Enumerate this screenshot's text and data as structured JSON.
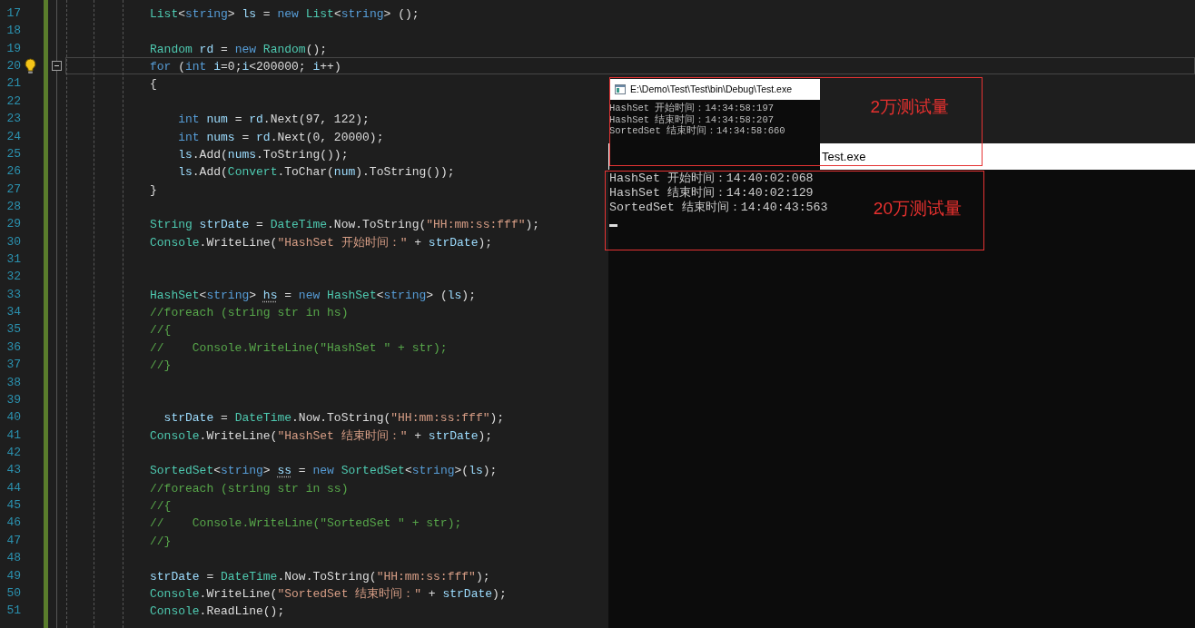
{
  "editor": {
    "lines": [
      {
        "number": "17",
        "current": false,
        "lightbulb": false,
        "fold": false,
        "tokens": [
          {
            "kind": "type",
            "text": "List"
          },
          {
            "kind": "plain",
            "text": "<"
          },
          {
            "kind": "keyword",
            "text": "string"
          },
          {
            "kind": "plain",
            "text": "> "
          },
          {
            "kind": "variable",
            "text": "ls"
          },
          {
            "kind": "plain",
            "text": " = "
          },
          {
            "kind": "keyword",
            "text": "new "
          },
          {
            "kind": "type",
            "text": "List"
          },
          {
            "kind": "plain",
            "text": "<"
          },
          {
            "kind": "keyword",
            "text": "string"
          },
          {
            "kind": "plain",
            "text": "> ();"
          }
        ]
      },
      {
        "number": "18",
        "current": false,
        "lightbulb": false,
        "fold": false
      },
      {
        "number": "19",
        "current": false,
        "lightbulb": false,
        "fold": false,
        "tokens": [
          {
            "kind": "type",
            "text": "Random "
          },
          {
            "kind": "variable",
            "text": "rd"
          },
          {
            "kind": "plain",
            "text": " = "
          },
          {
            "kind": "keyword",
            "text": "new "
          },
          {
            "kind": "type",
            "text": "Random"
          },
          {
            "kind": "plain",
            "text": "();"
          }
        ]
      },
      {
        "number": "20",
        "current": true,
        "lightbulb": true,
        "fold": true,
        "tokens": [
          {
            "kind": "keyword",
            "text": "for"
          },
          {
            "kind": "plain",
            "text": " ("
          },
          {
            "kind": "keyword",
            "text": "int "
          },
          {
            "kind": "variable",
            "text": "i"
          },
          {
            "kind": "plain",
            "text": "=0;"
          },
          {
            "kind": "variable",
            "text": "i"
          },
          {
            "kind": "plain",
            "text": "<200000; "
          },
          {
            "kind": "variable",
            "text": "i"
          },
          {
            "kind": "plain",
            "text": "++)"
          }
        ]
      },
      {
        "number": "21",
        "current": false,
        "lightbulb": false,
        "fold": false,
        "tokens": [
          {
            "kind": "plain",
            "text": "{"
          }
        ]
      },
      {
        "number": "22",
        "current": false,
        "lightbulb": false,
        "fold": false
      },
      {
        "number": "23",
        "current": false,
        "lightbulb": false,
        "fold": false,
        "tokens": [
          {
            "kind": "keyword",
            "text": "    int "
          },
          {
            "kind": "variable",
            "text": "num"
          },
          {
            "kind": "plain",
            "text": " = "
          },
          {
            "kind": "variable",
            "text": "rd"
          },
          {
            "kind": "plain",
            "text": ".Next(97, 122);"
          }
        ]
      },
      {
        "number": "24",
        "current": false,
        "lightbulb": false,
        "fold": false,
        "tokens": [
          {
            "kind": "keyword",
            "text": "    int "
          },
          {
            "kind": "variable",
            "text": "nums"
          },
          {
            "kind": "plain",
            "text": " = "
          },
          {
            "kind": "variable",
            "text": "rd"
          },
          {
            "kind": "plain",
            "text": ".Next(0, 20000);"
          }
        ]
      },
      {
        "number": "25",
        "current": false,
        "lightbulb": false,
        "fold": false,
        "tokens": [
          {
            "kind": "variable",
            "text": "    ls"
          },
          {
            "kind": "plain",
            "text": ".Add("
          },
          {
            "kind": "variable",
            "text": "nums"
          },
          {
            "kind": "plain",
            "text": ".ToString());"
          }
        ]
      },
      {
        "number": "26",
        "current": false,
        "lightbulb": false,
        "fold": false,
        "tokens": [
          {
            "kind": "variable",
            "text": "    ls"
          },
          {
            "kind": "plain",
            "text": ".Add("
          },
          {
            "kind": "type",
            "text": "Convert"
          },
          {
            "kind": "plain",
            "text": ".ToChar("
          },
          {
            "kind": "variable",
            "text": "num"
          },
          {
            "kind": "plain",
            "text": ").ToString());"
          }
        ]
      },
      {
        "number": "27",
        "current": false,
        "lightbulb": false,
        "fold": false,
        "tokens": [
          {
            "kind": "plain",
            "text": "}"
          }
        ]
      },
      {
        "number": "28",
        "current": false,
        "lightbulb": false,
        "fold": false
      },
      {
        "number": "29",
        "current": false,
        "lightbulb": false,
        "fold": false,
        "tokens": [
          {
            "kind": "type",
            "text": "String "
          },
          {
            "kind": "variable",
            "text": "strDate"
          },
          {
            "kind": "plain",
            "text": " = "
          },
          {
            "kind": "type",
            "text": "DateTime"
          },
          {
            "kind": "plain",
            "text": ".Now.ToString("
          },
          {
            "kind": "string",
            "text": "\"HH:mm:ss:fff\""
          },
          {
            "kind": "plain",
            "text": ");"
          }
        ]
      },
      {
        "number": "30",
        "current": false,
        "lightbulb": false,
        "fold": false,
        "tokens": [
          {
            "kind": "type",
            "text": "Console"
          },
          {
            "kind": "plain",
            "text": ".WriteLine("
          },
          {
            "kind": "string",
            "text": "\"HashSet 开始时间：\""
          },
          {
            "kind": "plain",
            "text": " + "
          },
          {
            "kind": "variable",
            "text": "strDate"
          },
          {
            "kind": "plain",
            "text": ");"
          }
        ]
      },
      {
        "number": "31",
        "current": false,
        "lightbulb": false,
        "fold": false
      },
      {
        "number": "32",
        "current": false,
        "lightbulb": false,
        "fold": false
      },
      {
        "number": "33",
        "current": false,
        "lightbulb": false,
        "fold": false,
        "tokens": [
          {
            "kind": "type",
            "text": "HashSet"
          },
          {
            "kind": "plain",
            "text": "<"
          },
          {
            "kind": "keyword",
            "text": "string"
          },
          {
            "kind": "plain",
            "text": "> "
          },
          {
            "kind": "variable",
            "text": "hs",
            "suggestion": true
          },
          {
            "kind": "plain",
            "text": " = "
          },
          {
            "kind": "keyword",
            "text": "new "
          },
          {
            "kind": "type",
            "text": "HashSet"
          },
          {
            "kind": "plain",
            "text": "<"
          },
          {
            "kind": "keyword",
            "text": "string"
          },
          {
            "kind": "plain",
            "text": "> ("
          },
          {
            "kind": "variable",
            "text": "ls"
          },
          {
            "kind": "plain",
            "text": ");"
          }
        ]
      },
      {
        "number": "34",
        "current": false,
        "lightbulb": false,
        "fold": false,
        "tokens": [
          {
            "kind": "comment",
            "text": "//foreach (string str in hs)"
          }
        ]
      },
      {
        "number": "35",
        "current": false,
        "lightbulb": false,
        "fold": false,
        "tokens": [
          {
            "kind": "comment",
            "text": "//{"
          }
        ]
      },
      {
        "number": "36",
        "current": false,
        "lightbulb": false,
        "fold": false,
        "tokens": [
          {
            "kind": "comment",
            "text": "//    Console.WriteLine(\"HashSet \" + str);"
          }
        ]
      },
      {
        "number": "37",
        "current": false,
        "lightbulb": false,
        "fold": false,
        "tokens": [
          {
            "kind": "comment",
            "text": "//}"
          }
        ]
      },
      {
        "number": "38",
        "current": false,
        "lightbulb": false,
        "fold": false
      },
      {
        "number": "39",
        "current": false,
        "lightbulb": false,
        "fold": false
      },
      {
        "number": "40",
        "current": false,
        "lightbulb": false,
        "fold": false,
        "tokens": [
          {
            "kind": "variable",
            "text": "  strDate"
          },
          {
            "kind": "plain",
            "text": " = "
          },
          {
            "kind": "type",
            "text": "DateTime"
          },
          {
            "kind": "plain",
            "text": ".Now.ToString("
          },
          {
            "kind": "string",
            "text": "\"HH:mm:ss:fff\""
          },
          {
            "kind": "plain",
            "text": ");"
          }
        ]
      },
      {
        "number": "41",
        "current": false,
        "lightbulb": false,
        "fold": false,
        "tokens": [
          {
            "kind": "type",
            "text": "Console"
          },
          {
            "kind": "plain",
            "text": ".WriteLine("
          },
          {
            "kind": "string",
            "text": "\"HashSet 结束时间：\""
          },
          {
            "kind": "plain",
            "text": " + "
          },
          {
            "kind": "variable",
            "text": "strDate"
          },
          {
            "kind": "plain",
            "text": ");"
          }
        ]
      },
      {
        "number": "42",
        "current": false,
        "lightbulb": false,
        "fold": false
      },
      {
        "number": "43",
        "current": false,
        "lightbulb": false,
        "fold": false,
        "tokens": [
          {
            "kind": "type",
            "text": "SortedSet"
          },
          {
            "kind": "plain",
            "text": "<"
          },
          {
            "kind": "keyword",
            "text": "string"
          },
          {
            "kind": "plain",
            "text": "> "
          },
          {
            "kind": "variable",
            "text": "ss",
            "suggestion": true
          },
          {
            "kind": "plain",
            "text": " = "
          },
          {
            "kind": "keyword",
            "text": "new "
          },
          {
            "kind": "type",
            "text": "SortedSet"
          },
          {
            "kind": "plain",
            "text": "<"
          },
          {
            "kind": "keyword",
            "text": "string"
          },
          {
            "kind": "plain",
            "text": ">("
          },
          {
            "kind": "variable",
            "text": "ls"
          },
          {
            "kind": "plain",
            "text": ");"
          }
        ]
      },
      {
        "number": "44",
        "current": false,
        "lightbulb": false,
        "fold": false,
        "tokens": [
          {
            "kind": "comment",
            "text": "//foreach (string str in ss)"
          }
        ]
      },
      {
        "number": "45",
        "current": false,
        "lightbulb": false,
        "fold": false,
        "tokens": [
          {
            "kind": "comment",
            "text": "//{"
          }
        ]
      },
      {
        "number": "46",
        "current": false,
        "lightbulb": false,
        "fold": false,
        "tokens": [
          {
            "kind": "comment",
            "text": "//    Console.WriteLine(\"SortedSet \" + str);"
          }
        ]
      },
      {
        "number": "47",
        "current": false,
        "lightbulb": false,
        "fold": false,
        "tokens": [
          {
            "kind": "comment",
            "text": "//}"
          }
        ]
      },
      {
        "number": "48",
        "current": false,
        "lightbulb": false,
        "fold": false
      },
      {
        "number": "49",
        "current": false,
        "lightbulb": false,
        "fold": false,
        "tokens": [
          {
            "kind": "variable",
            "text": "strDate"
          },
          {
            "kind": "plain",
            "text": " = "
          },
          {
            "kind": "type",
            "text": "DateTime"
          },
          {
            "kind": "plain",
            "text": ".Now.ToString("
          },
          {
            "kind": "string",
            "text": "\"HH:mm:ss:fff\""
          },
          {
            "kind": "plain",
            "text": ");"
          }
        ]
      },
      {
        "number": "50",
        "current": false,
        "lightbulb": false,
        "fold": false,
        "tokens": [
          {
            "kind": "type",
            "text": "Console"
          },
          {
            "kind": "plain",
            "text": ".WriteLine("
          },
          {
            "kind": "string",
            "text": "\"SortedSet 结束时间：\""
          },
          {
            "kind": "plain",
            "text": " + "
          },
          {
            "kind": "variable",
            "text": "strDate"
          },
          {
            "kind": "plain",
            "text": ");"
          }
        ]
      },
      {
        "number": "51",
        "current": false,
        "lightbulb": false,
        "fold": false,
        "tokens": [
          {
            "kind": "type",
            "text": "Console"
          },
          {
            "kind": "plain",
            "text": ".ReadLine();"
          }
        ]
      }
    ]
  },
  "console_window": {
    "title": "Test.exe",
    "lines": [
      "HashSet 开始时间：14:40:02:068",
      "HashSet 结束时间：14:40:02:129",
      "SortedSet 结束时间：14:40:43:563"
    ],
    "cursor": true
  },
  "popup_console": {
    "title": "E:\\Demo\\Test\\Test\\bin\\Debug\\Test.exe",
    "lines": [
      "HashSet 开始时间：14:34:58:197",
      "HashSet 结束时间：14:34:58:207",
      "SortedSet 结束时间：14:34:58:660"
    ]
  },
  "annotations": [
    {
      "text": "2万测试量"
    },
    {
      "text": "20万测试量"
    }
  ]
}
